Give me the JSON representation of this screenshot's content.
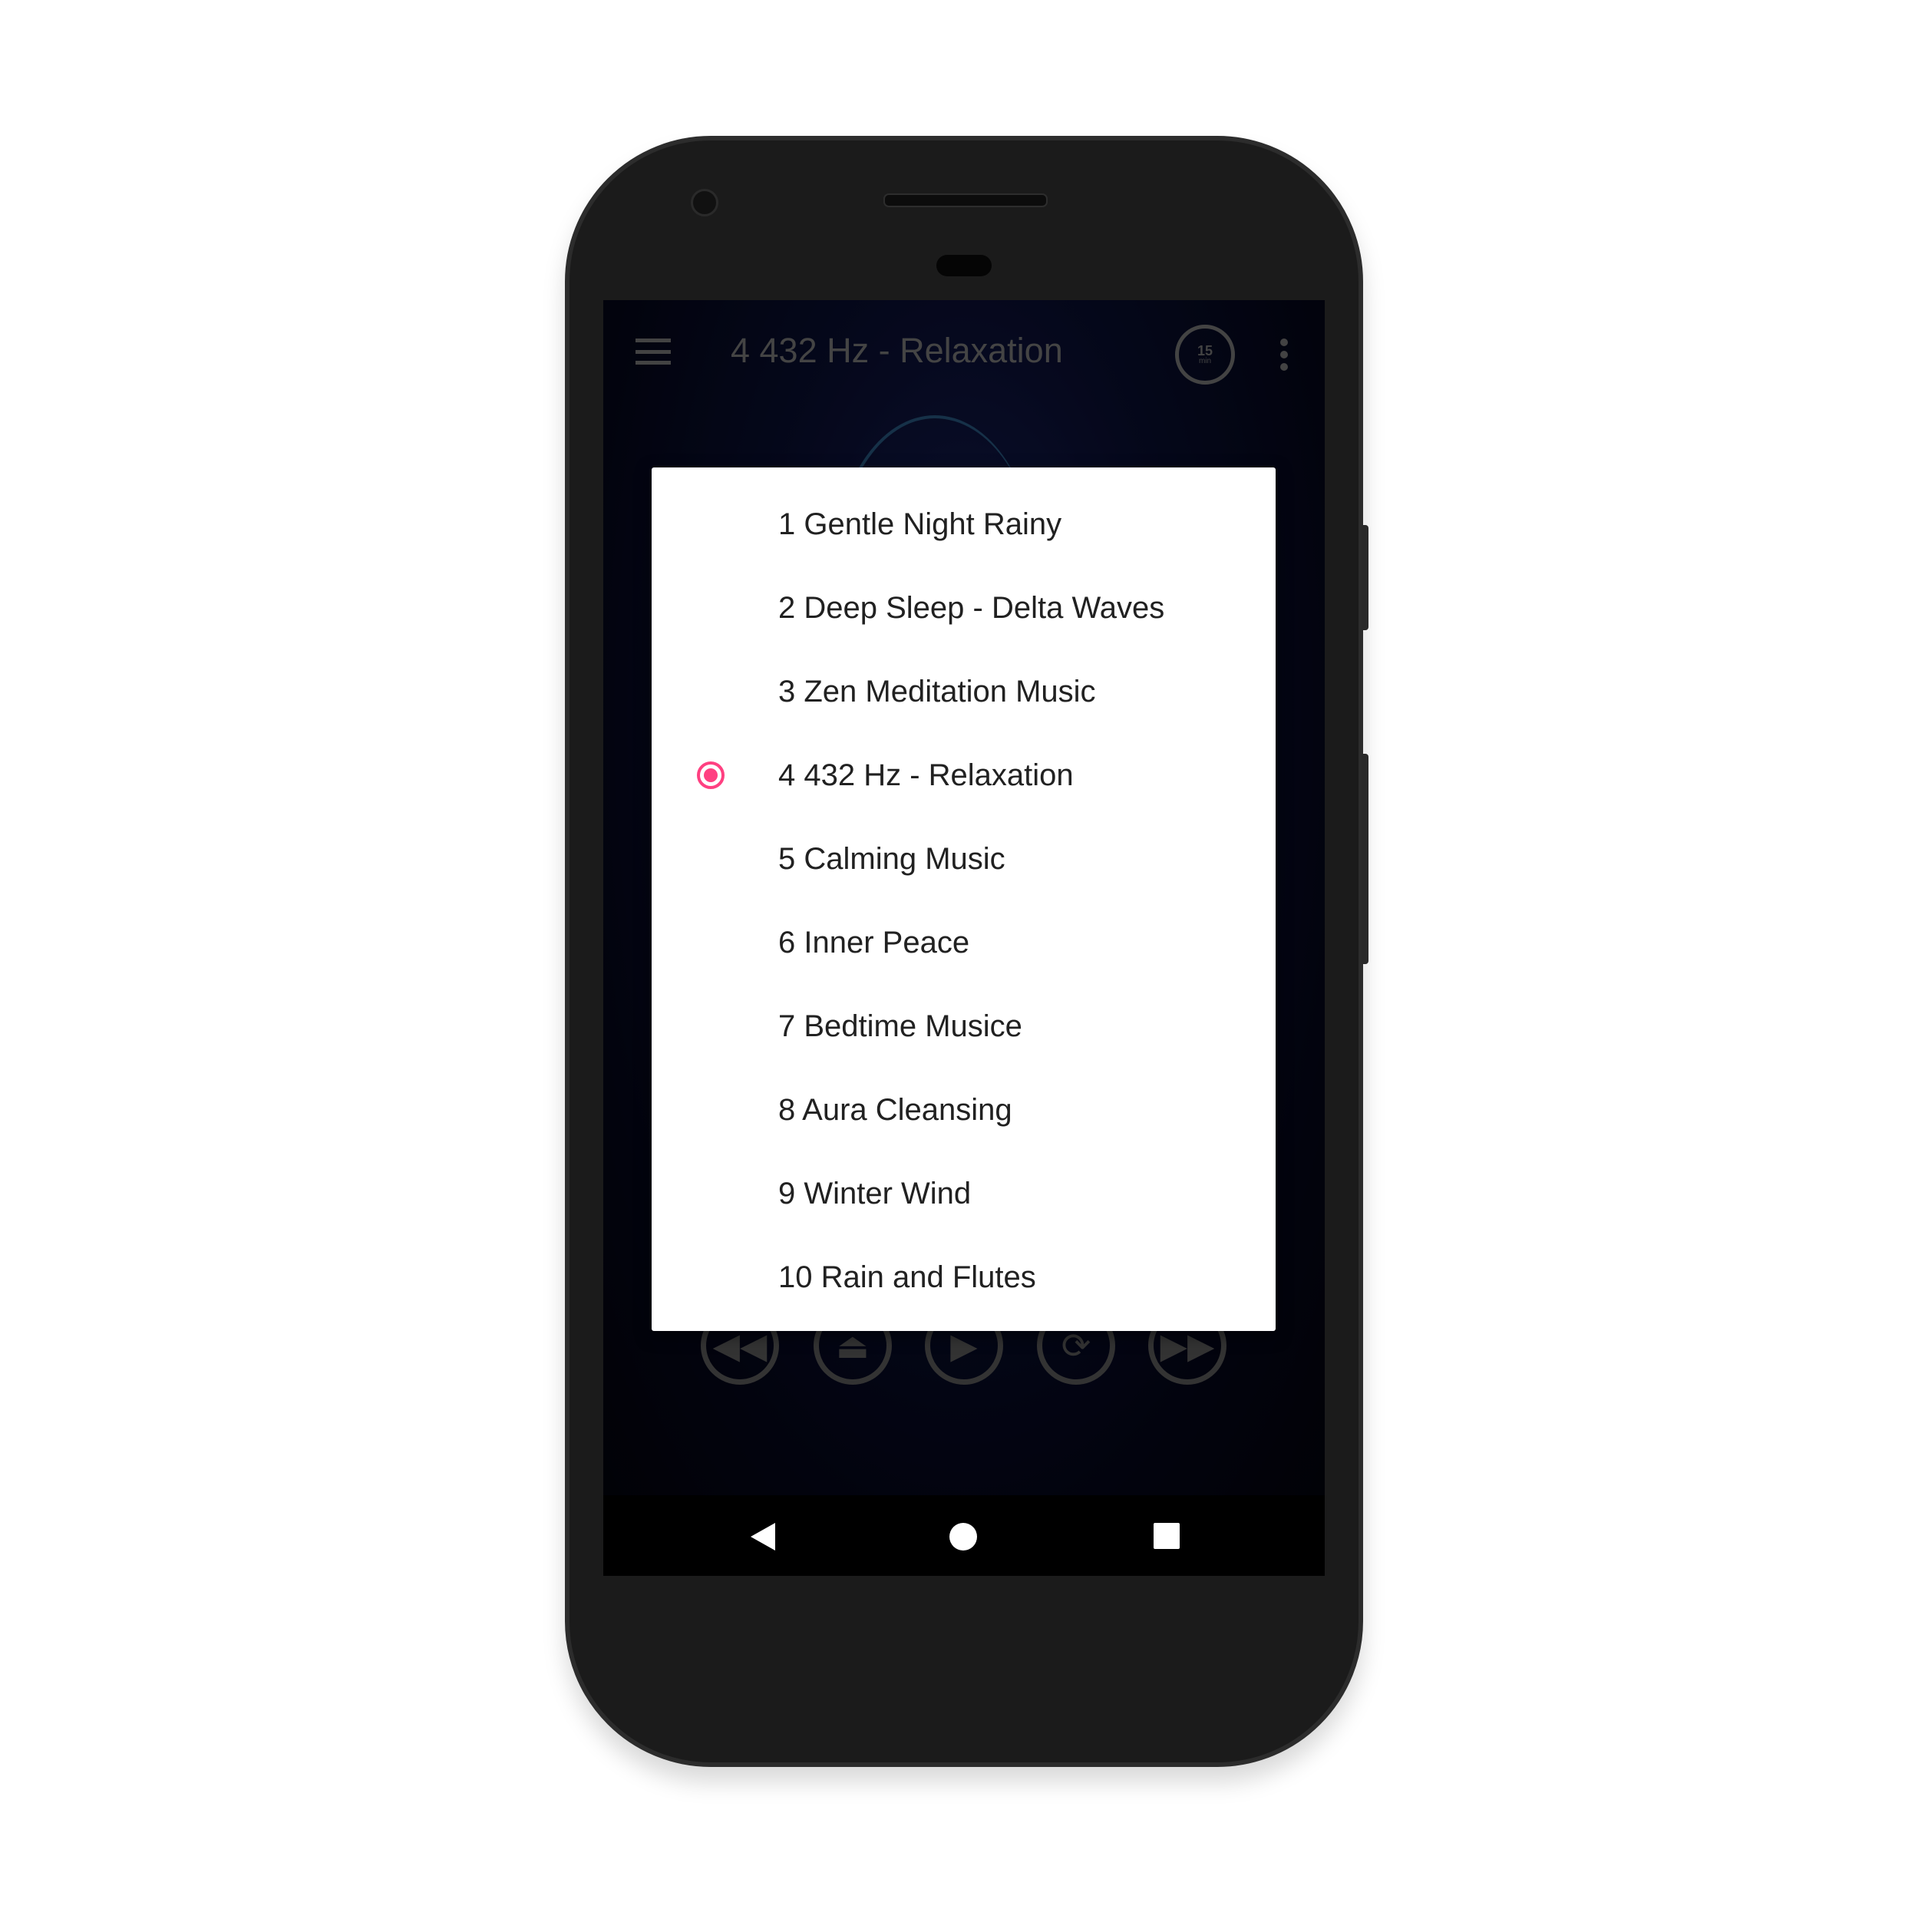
{
  "app": {
    "title": "4 432 Hz - Relaxation",
    "timer": {
      "value": "15",
      "unit": "min"
    }
  },
  "dialog": {
    "selected_index": 3,
    "accent_color": "#ff4081",
    "items": [
      {
        "label": "1 Gentle Night Rainy"
      },
      {
        "label": "2 Deep Sleep - Delta Waves"
      },
      {
        "label": "3 Zen Meditation Music"
      },
      {
        "label": "4 432 Hz - Relaxation"
      },
      {
        "label": "5 Calming Music"
      },
      {
        "label": "6 Inner Peace"
      },
      {
        "label": "7 Bedtime Musice"
      },
      {
        "label": "8 Aura Cleansing"
      },
      {
        "label": "9 Winter Wind"
      },
      {
        "label": "10 Rain and Flutes"
      }
    ]
  },
  "controls": [
    "rewind-icon",
    "eject-icon",
    "play-icon",
    "repeat-icon",
    "fast-forward-icon"
  ],
  "navbar": [
    "back-icon",
    "home-icon",
    "recents-icon"
  ]
}
